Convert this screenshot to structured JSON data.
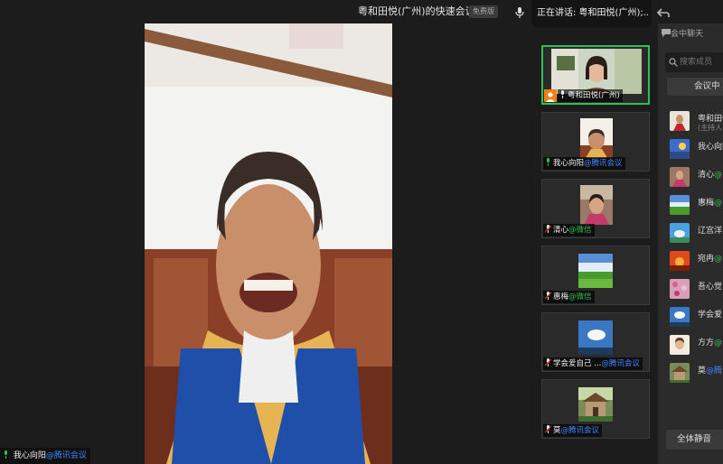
{
  "header": {
    "meeting_title": "粤和田悦(广州)的快速会议",
    "badge": "免费版",
    "speaking": "正在讲话: 粤和田悦(广州);..."
  },
  "main_video": {
    "name": "我心向阳",
    "tag": "@腾讯会议"
  },
  "tiles": [
    {
      "name": "粤和田悦(广州)",
      "tag": "",
      "host": true
    },
    {
      "name": "我心向阳",
      "tag": "@腾讯会议",
      "tag_type": "tx"
    },
    {
      "name": "清心",
      "tag": "@微信",
      "tag_type": "wx"
    },
    {
      "name": "惠梅",
      "tag": "@微信",
      "tag_type": "wx"
    },
    {
      "name": "学会爱自己 ...",
      "tag": "@腾讯会议",
      "tag_type": "tx"
    },
    {
      "name": "莫",
      "tag": "@腾讯会议",
      "tag_type": "tx"
    }
  ],
  "panel": {
    "chat_tab": "会中聊天",
    "search_placeholder": "搜索成员",
    "in_meeting_tab": "会议中",
    "mute_all": "全体静音",
    "participants": [
      {
        "name": "粤和田悦",
        "sub": "(主持人",
        "tag": ""
      },
      {
        "name": "我心向阳",
        "tag": ""
      },
      {
        "name": "清心",
        "tag": "@",
        "tag_type": "wx"
      },
      {
        "name": "惠梅",
        "tag": "@",
        "tag_type": "wx"
      },
      {
        "name": "辽宫洋",
        "tag": ""
      },
      {
        "name": "宛冉",
        "tag": "@",
        "tag_type": "wx"
      },
      {
        "name": "吾心觉",
        "tag": ""
      },
      {
        "name": "学会爱",
        "tag": ""
      },
      {
        "name": "方方",
        "tag": "@",
        "tag_type": "wx"
      },
      {
        "name": "莫",
        "tag": "@腾",
        "tag_type": "tx"
      }
    ]
  },
  "colors": {
    "accent_green": "#2fbf55",
    "link_blue": "#3d86ff",
    "host_orange": "#f07f18",
    "background": "#1c1c1c"
  }
}
